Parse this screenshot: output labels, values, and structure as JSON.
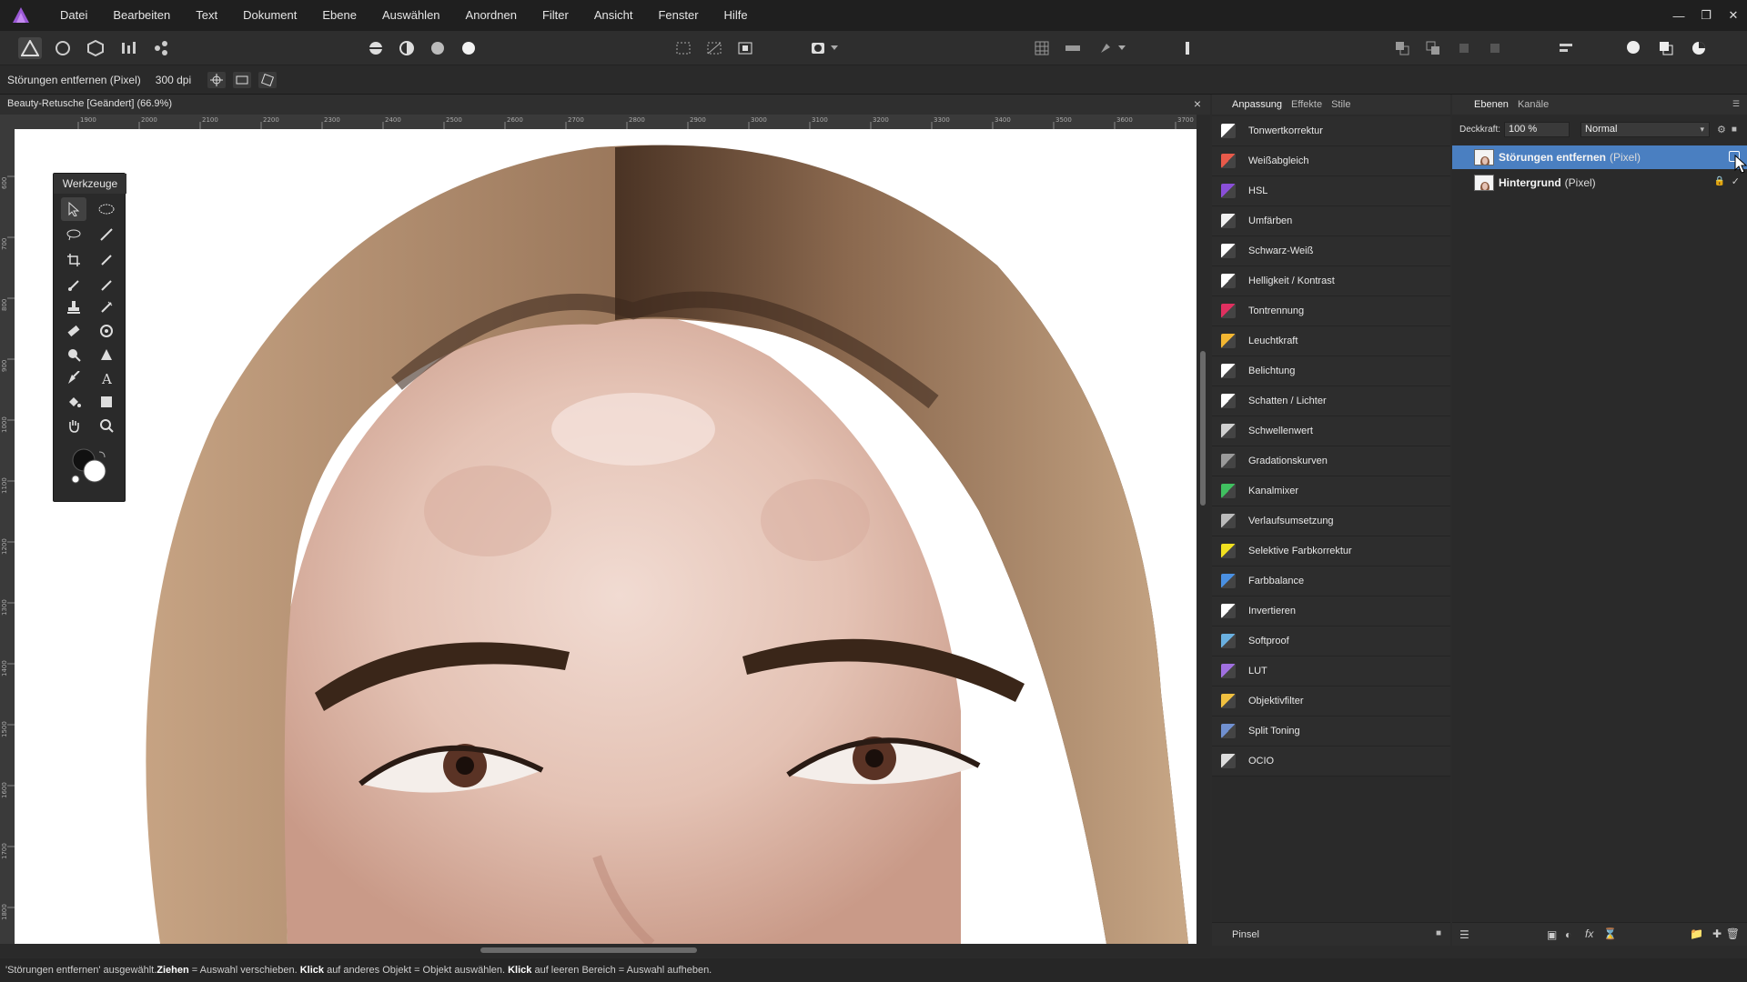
{
  "menu": [
    "Datei",
    "Bearbeiten",
    "Text",
    "Dokument",
    "Ebene",
    "Auswählen",
    "Anordnen",
    "Filter",
    "Ansicht",
    "Fenster",
    "Hilfe"
  ],
  "context": {
    "tool_name": "Störungen entfernen (Pixel)",
    "dpi": "300 dpi"
  },
  "document": {
    "title": "Beauty-Retusche [Geändert] (66.9%)"
  },
  "ruler": {
    "h_ticks": [
      "1900",
      "2000",
      "2100",
      "2200",
      "2300",
      "2400",
      "2500",
      "2600",
      "2700",
      "2800",
      "2900",
      "3000",
      "3100",
      "3200",
      "3300",
      "3400",
      "3500",
      "3600",
      "3700"
    ],
    "v_ticks": [
      "600",
      "700",
      "800",
      "900",
      "1000",
      "1100",
      "1200",
      "1300",
      "1400",
      "1500",
      "1600",
      "1700",
      "1800"
    ]
  },
  "tools_panel": {
    "title": "Werkzeuge"
  },
  "adjustment_panel": {
    "tabs": [
      "Anpassung",
      "Effekte",
      "Stile"
    ],
    "items": [
      {
        "label": "Tonwertkorrektur",
        "color": "#ffffff"
      },
      {
        "label": "Weißabgleich",
        "color": "#e85a4a"
      },
      {
        "label": "HSL",
        "color": "#8a4fd8"
      },
      {
        "label": "Umfärben",
        "color": "#f0f0f0"
      },
      {
        "label": "Schwarz-Weiß",
        "color": "#ffffff"
      },
      {
        "label": "Helligkeit / Kontrast",
        "color": "#ffffff"
      },
      {
        "label": "Tontrennung",
        "color": "#e03060"
      },
      {
        "label": "Leuchtkraft",
        "color": "#f2b632"
      },
      {
        "label": "Belichtung",
        "color": "#ffffff"
      },
      {
        "label": "Schatten / Lichter",
        "color": "#ffffff"
      },
      {
        "label": "Schwellenwert",
        "color": "#cfcfcf"
      },
      {
        "label": "Gradationskurven",
        "color": "#9a9a9a"
      },
      {
        "label": "Kanalmixer",
        "color": "#40c060"
      },
      {
        "label": "Verlaufsumsetzung",
        "color": "#bbbbbb"
      },
      {
        "label": "Selektive Farbkorrektur",
        "color": "#f0e020"
      },
      {
        "label": "Farbbalance",
        "color": "#4a90e2"
      },
      {
        "label": "Invertieren",
        "color": "#ffffff"
      },
      {
        "label": "Softproof",
        "color": "#6ab0e0"
      },
      {
        "label": "LUT",
        "color": "#a070e0"
      },
      {
        "label": "Objektivfilter",
        "color": "#f0c040"
      },
      {
        "label": "Split Toning",
        "color": "#7090d0"
      },
      {
        "label": "OCIO",
        "color": "#dddddd"
      }
    ],
    "brush_label": "Pinsel"
  },
  "layers_panel": {
    "tabs": [
      "Ebenen",
      "Kanäle"
    ],
    "opacity_label": "Deckkraft:",
    "opacity_value": "100 %",
    "blend_mode": "Normal",
    "layers": [
      {
        "name": "Störungen entfernen",
        "type": "(Pixel)"
      },
      {
        "name": "Hintergrund",
        "type": "(Pixel)"
      }
    ]
  },
  "status": {
    "part1": "'Störungen entfernen' ausgewählt. ",
    "bold1": "Ziehen",
    "part2": " = Auswahl verschieben. ",
    "bold2": "Klick",
    "part3": " auf anderes Objekt = Objekt auswählen. ",
    "bold3": "Klick",
    "part4": " auf leeren Bereich = Auswahl aufheben."
  },
  "colors": {
    "accent": "#4a7fc1",
    "app_logo": "#9b59d6"
  }
}
